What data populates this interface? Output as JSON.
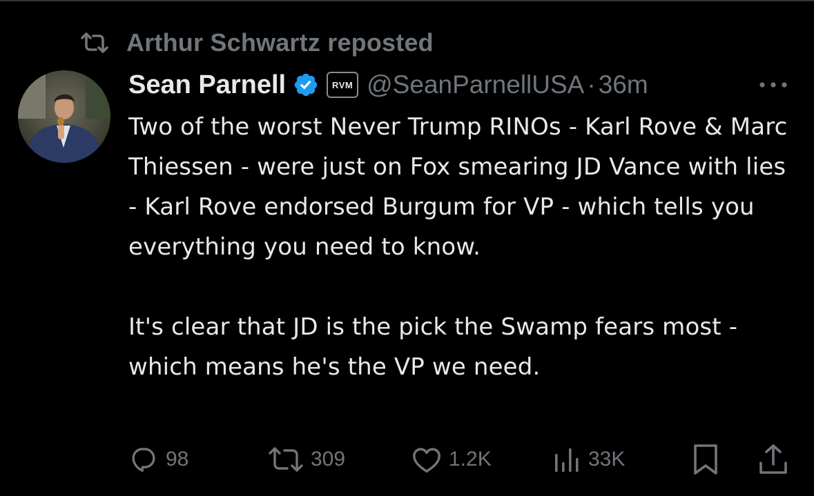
{
  "repost": {
    "text": "Arthur Schwartz reposted",
    "icon": "repost-icon"
  },
  "author": {
    "name": "Sean Parnell",
    "affiliate_badge": "RVM",
    "handle": "@SeanParnellUSA",
    "separator": "·",
    "time": "36m",
    "verified_color": "#1d9bf0"
  },
  "tweet": {
    "paragraphs": [
      "Two of the worst Never Trump RINOs - Karl Rove & Marc Thiessen - were just on Fox smearing JD Vance with lies - Karl Rove endorsed Burgum for VP - which tells you everything you need to know.",
      "It's clear that JD is the pick the Swamp fears most - which means he's the VP we need."
    ]
  },
  "actions": {
    "replies": "98",
    "reposts": "309",
    "likes": "1.2K",
    "views": "33K"
  },
  "colors": {
    "background": "#000000",
    "text": "#e7e9ea",
    "secondary": "#71767b"
  }
}
